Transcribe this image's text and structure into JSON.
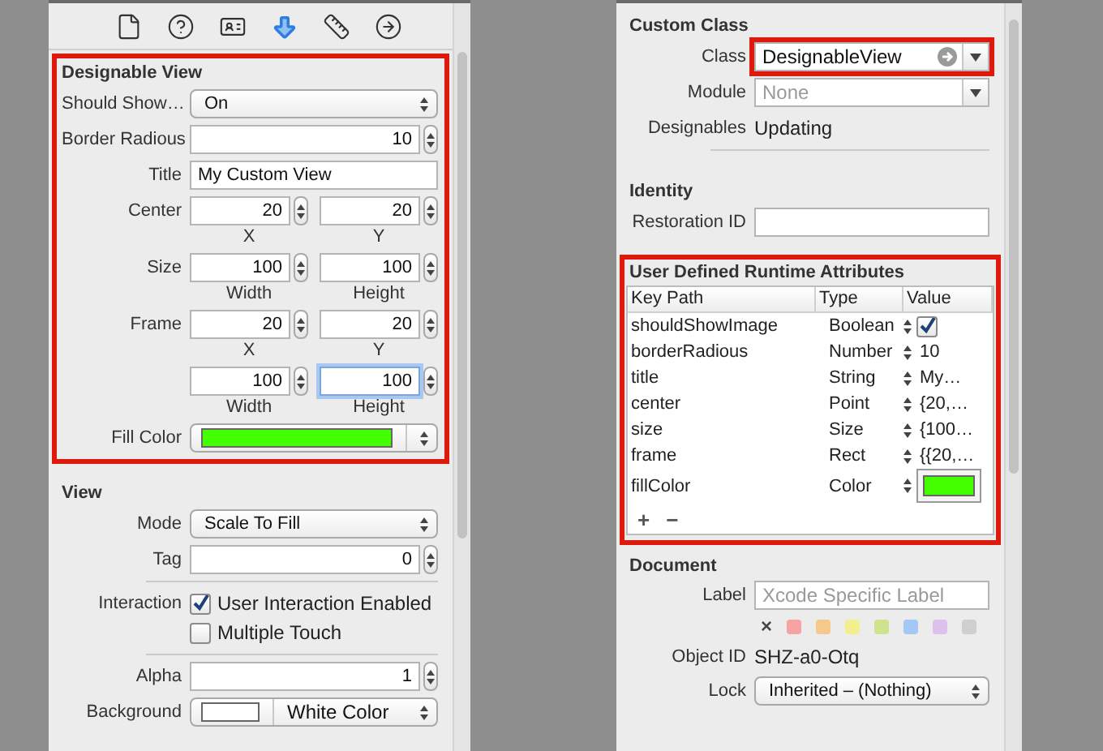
{
  "inspector_tabs": [
    {
      "kind": "file",
      "selected": false
    },
    {
      "kind": "help",
      "selected": false
    },
    {
      "kind": "identity",
      "selected": false
    },
    {
      "kind": "attributes",
      "selected": true
    },
    {
      "kind": "size",
      "selected": false
    },
    {
      "kind": "connections",
      "selected": false
    }
  ],
  "designable_view": {
    "title": "Designable View",
    "highlighted": true,
    "rows": [
      {
        "kind": "select",
        "label": "Should Show…",
        "value": "On"
      },
      {
        "kind": "stepper",
        "label": "Border Radious",
        "value": "10"
      },
      {
        "kind": "text",
        "label": "Title",
        "value": "My Custom View"
      },
      {
        "kind": "pair",
        "label": "Center",
        "fields": [
          {
            "value": "20",
            "caption": "X",
            "focused": false
          },
          {
            "value": "20",
            "caption": "Y",
            "focused": false
          }
        ]
      },
      {
        "kind": "pair",
        "label": "Size",
        "fields": [
          {
            "value": "100",
            "caption": "Width",
            "focused": false
          },
          {
            "value": "100",
            "caption": "Height",
            "focused": false
          }
        ]
      },
      {
        "kind": "pair",
        "label": "Frame",
        "fields": [
          {
            "value": "20",
            "caption": "X",
            "focused": false
          },
          {
            "value": "20",
            "caption": "Y",
            "focused": false
          }
        ]
      },
      {
        "kind": "pair",
        "fields": [
          {
            "value": "100",
            "caption": "Width",
            "focused": false
          },
          {
            "value": "100",
            "caption": "Height",
            "focused": true
          }
        ]
      },
      {
        "kind": "color",
        "label": "Fill Color",
        "color": "#44ff00"
      }
    ]
  },
  "view": {
    "title": "View",
    "highlighted": false,
    "rows": [
      {
        "kind": "select",
        "label": "Mode",
        "value": "Scale To Fill"
      },
      {
        "kind": "stepper",
        "label": "Tag",
        "value": "0"
      },
      {
        "kind": "divider"
      },
      {
        "kind": "checks",
        "label": "Interaction",
        "items": [
          {
            "label": "User Interaction Enabled",
            "checked": true
          },
          {
            "label": "Multiple Touch",
            "checked": false
          }
        ]
      },
      {
        "kind": "divider"
      },
      {
        "kind": "stepper",
        "label": "Alpha",
        "value": "1"
      },
      {
        "kind": "colorselect",
        "label": "Background",
        "color": "#ffffff",
        "value": "White Color"
      }
    ]
  },
  "custom_class": {
    "title": "Custom Class",
    "highlighted": false,
    "rows": [
      {
        "kind": "combo",
        "label": "Class",
        "value": "DesignableView",
        "highlighted": true
      },
      {
        "kind": "combo",
        "label": "Module",
        "placeholder": "None",
        "highlighted": false
      },
      {
        "kind": "info",
        "label": "Designables",
        "value": "Updating"
      },
      {
        "kind": "divider"
      }
    ]
  },
  "identity": {
    "title": "Identity",
    "highlighted": false,
    "rows": [
      {
        "kind": "text",
        "label": "Restoration ID"
      }
    ]
  },
  "runtime_attributes": {
    "title": "User Defined Runtime Attributes",
    "highlighted": true,
    "columns": [
      "Key Path",
      "Type",
      "Value"
    ],
    "rows": [
      {
        "key_path": "shouldShowImage",
        "type": "Boolean",
        "kind": "checkbox",
        "checked": true
      },
      {
        "key_path": "borderRadious",
        "type": "Number",
        "kind": "text",
        "value": "10"
      },
      {
        "key_path": "title",
        "type": "String",
        "kind": "text",
        "value": "My…"
      },
      {
        "key_path": "center",
        "type": "Point",
        "kind": "text",
        "value": "{20,…"
      },
      {
        "key_path": "size",
        "type": "Size",
        "kind": "text",
        "value": "{100…"
      },
      {
        "key_path": "frame",
        "type": "Rect",
        "kind": "text",
        "value": "{{20,…"
      },
      {
        "key_path": "fillColor",
        "type": "Color",
        "kind": "color",
        "color": "#44ff00"
      }
    ],
    "buttons": [
      "+",
      "−"
    ]
  },
  "document": {
    "title": "Document",
    "label_label": "Label",
    "label_placeholder": "Xcode Specific Label",
    "clear": "×",
    "label_colors": [
      {
        "color": "#f5a3a3"
      },
      {
        "color": "#f6c98a"
      },
      {
        "color": "#f3ee8e"
      },
      {
        "color": "#cfe38f"
      },
      {
        "color": "#a4c8f6"
      },
      {
        "color": "#dcc1ef"
      },
      {
        "color": "#cfcfcf"
      }
    ],
    "object_id_label": "Object ID",
    "object_id": "SHZ-a0-Otq",
    "lock_label": "Lock",
    "lock": "Inherited – (Nothing)"
  }
}
